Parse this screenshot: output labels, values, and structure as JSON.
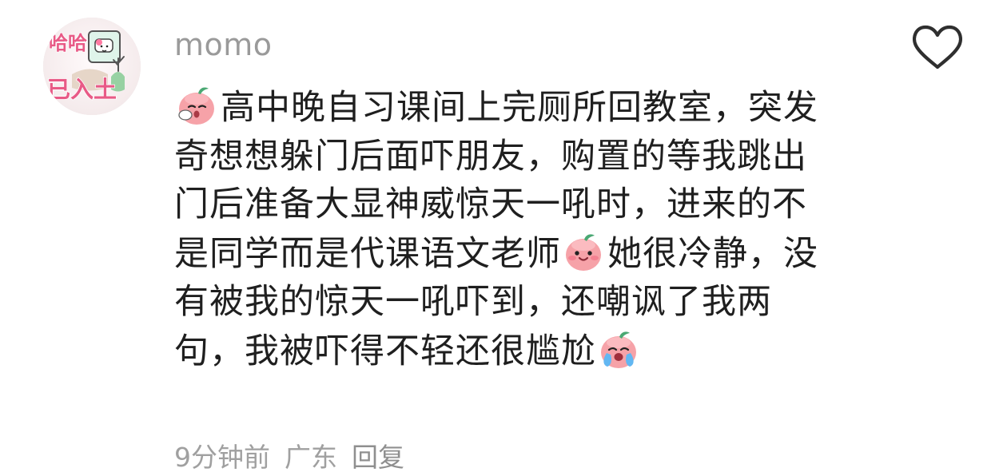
{
  "comment": {
    "avatar": {
      "icon": "cartoon-cat-avatar-icon",
      "text_top": "哈哈",
      "text_bottom": "已入土"
    },
    "username": "momo",
    "like_icon": "heart-outline-icon",
    "body": {
      "line1_text": "高中晚自习课间上完厕所回教室，突发",
      "line2_text": "奇想想躲门后面吓朋友，购置的等我跳出",
      "line3_text": "门后准备大显神威惊天一吼时，进来的不",
      "line4_before_emoji": "是同学而是代课语文老师",
      "line4_after_emoji": "她很冷静，没",
      "line5_text": "有被我的惊天一吼吓到，还嘲讽了我两",
      "line6_text": "句，我被吓得不轻还很尴尬",
      "emoji_1": "tired-peach-emoji",
      "emoji_2": "smiling-peach-emoji",
      "emoji_3": "crying-peach-emoji"
    },
    "meta": {
      "time": "9分钟前",
      "location": "广东",
      "reply_label": "回复"
    }
  },
  "colors": {
    "username": "#9a9a9a",
    "body_text": "#1f1f1f",
    "meta": "#a0a0a0",
    "heart_stroke": "#2f2f2f",
    "peach_fill": "#f8a0a6",
    "leaf": "#4aa873"
  }
}
